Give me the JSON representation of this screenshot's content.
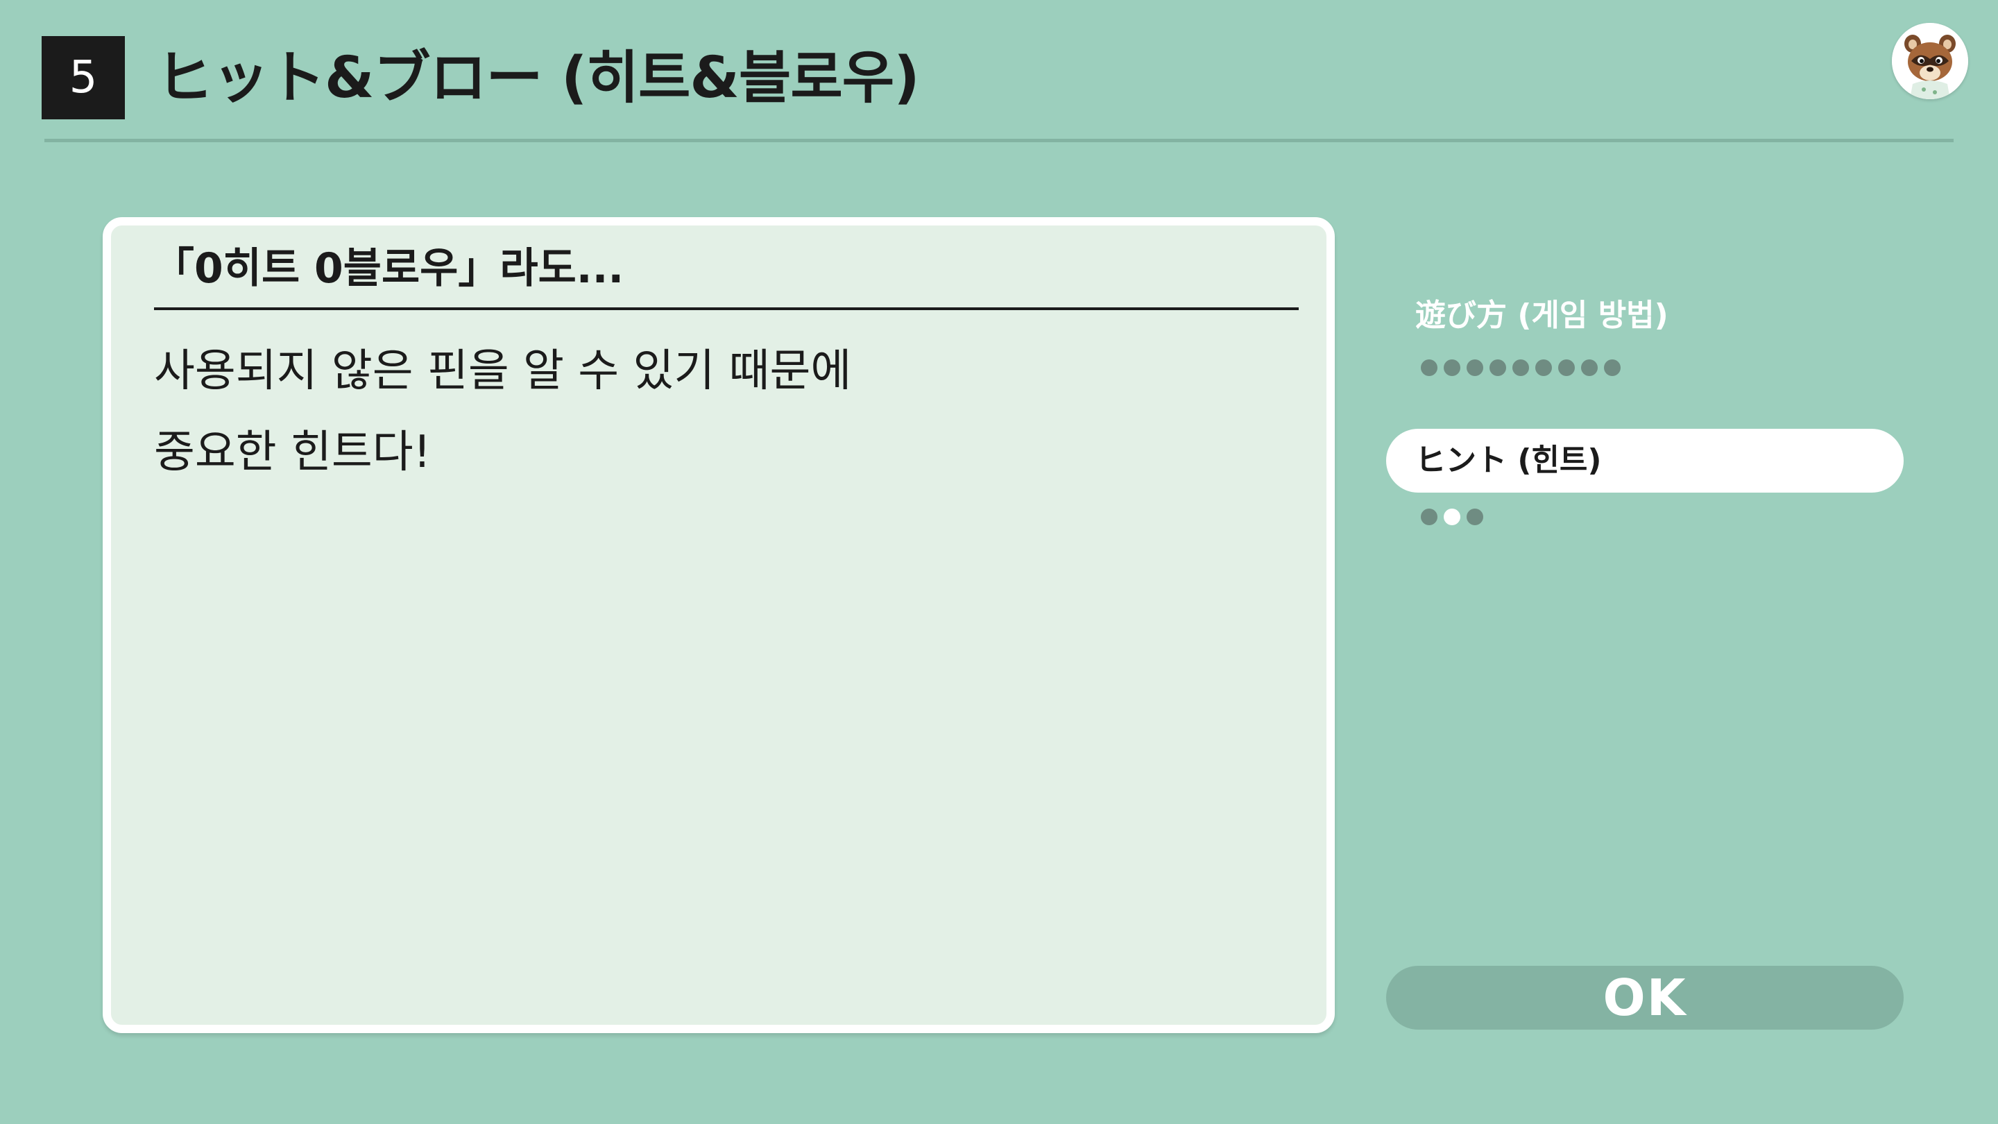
{
  "header": {
    "number": "5",
    "title": "ヒット&ブロー (히트&블로우)"
  },
  "card": {
    "heading": "「0히트 0블로우」라도...",
    "lines": [
      "사용되지 않은 핀을 알 수 있기 때문에",
      "중요한 힌트다!"
    ]
  },
  "sidebar": {
    "items": [
      {
        "label": "遊び方 (게임 방법)",
        "pages": 9,
        "current_page": null,
        "selected": false
      },
      {
        "label": "ヒント (힌트)",
        "pages": 3,
        "current_page": 2,
        "selected": true
      }
    ]
  },
  "ok_button": {
    "label": "OK"
  },
  "icons": {
    "avatar": "raccoon-character-avatar"
  },
  "colors": {
    "background": "#9ccfbd",
    "card": "#e3f0e6",
    "ok_button": "#84b3a3",
    "dot_inactive": "#6f8c82",
    "dot_active": "#ffffff"
  }
}
